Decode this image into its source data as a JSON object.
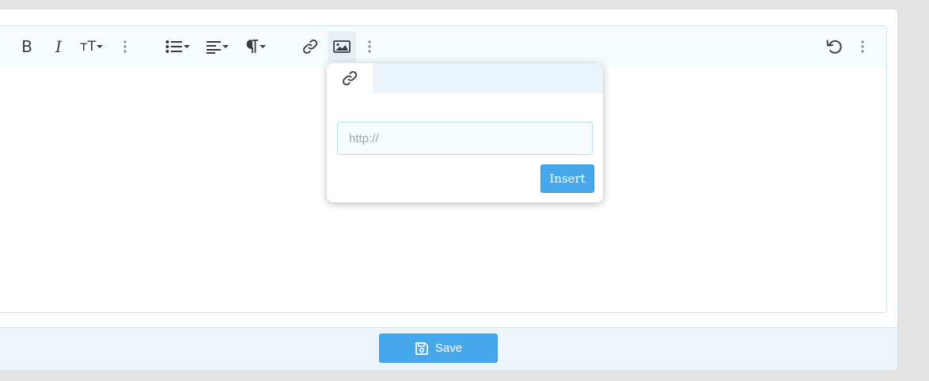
{
  "toolbar": {
    "buttons": [
      {
        "name": "bold",
        "glyph": "B"
      },
      {
        "name": "italic",
        "glyph": "I"
      },
      {
        "name": "text-size",
        "glyph": "тT"
      }
    ],
    "icons": [
      "bold-icon",
      "italic-icon",
      "text-size-icon",
      "more-text-icon",
      "list-icon",
      "align-icon",
      "paragraph-icon",
      "link-icon",
      "image-icon",
      "more-insert-icon",
      "undo-icon",
      "more-misc-icon"
    ]
  },
  "image_popup": {
    "tab_icon": "link-icon",
    "url_placeholder": "http://",
    "url_value": "",
    "insert_label": "Insert"
  },
  "footer": {
    "save_label": "Save",
    "save_icon": "floppy-disk-icon"
  },
  "colors": {
    "accent": "#47a7eb",
    "toolbar_bg": "#f6fbfe",
    "footer_bg": "#edf5fb",
    "page_bg": "#e3e3e3"
  }
}
